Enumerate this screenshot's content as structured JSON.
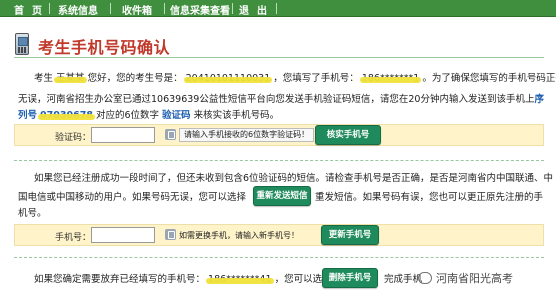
{
  "nav": {
    "items": [
      "首",
      "页",
      "系统信息",
      "收件箱",
      "信息采集查看",
      "退",
      "出"
    ]
  },
  "heading": {
    "title": "考生手机号码确认"
  },
  "intro": {
    "l1_a": "考生",
    "l1_name": "王某某",
    "l1_b": "您好，您的考生号是：",
    "l1_kaosheng": "20410101110031",
    "l1_c": "，您填写了手机号：",
    "l1_phone": "186*******1",
    "l1_d": "。为了确保您填写的手机号码正确",
    "l2_a": "无误，河南省招生办公室已通过10639639公益性短信平台向您发送手机验证码短信，请您在20分钟内输入发送到该手机上",
    "l2_b": "序",
    "l3_a": "列号",
    "l3_serial": "07030678",
    "l3_b": "对应的6位数字",
    "l3_c": "验证码",
    "l3_d": "来核实该手机号码。"
  },
  "verify_row": {
    "label": "验证码：",
    "input_value": "",
    "hint": "请输入手机接收的6位数字验证码！",
    "button": "核实手机号"
  },
  "resend": {
    "l1": "如果您已经注册成功一段时间了，但还未收到包含6位验证码的短信。请检查手机号是否正确，是否是河南省内中国联通、中",
    "l2_a": "国电信或中国移动的用户。如果号码无误，您可以选择",
    "l2_button": "重新发送短信",
    "l2_b": "重发短信。如果号码有误，您也可以更正原先注册的手",
    "l3": "机号。"
  },
  "update_row": {
    "label": "手机号：",
    "input_value": "",
    "hint": "如需更换手机，请输入新手机号！",
    "button": "更新手机号"
  },
  "delete": {
    "a": "如果您确定需要放弃已经填写的手机号：",
    "phone": "186*******41",
    "b": "，您可以选择",
    "button": "删除手机号",
    "c": "完成手机"
  },
  "watermark": {
    "text": "河南省阳光高考"
  },
  "colors": {
    "nav_bg": "#3f8f3f",
    "title": "#c0392b",
    "button": "#1f8a5b",
    "row_bg": "#fff3c9",
    "link_blue": "#1f5fb0"
  }
}
